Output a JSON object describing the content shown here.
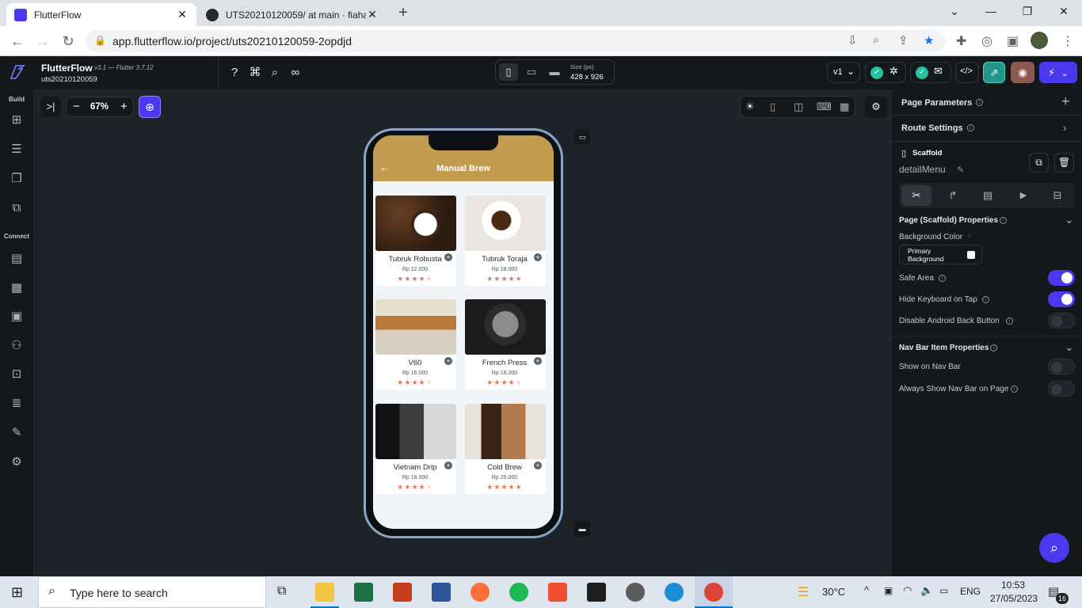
{
  "browser": {
    "tabs": [
      {
        "title": "FlutterFlow",
        "active": true
      },
      {
        "title": "UTS20210120059/ at main · fiaha",
        "active": false
      }
    ],
    "new_tab": "+",
    "window_controls": [
      "⌄",
      "—",
      "❐",
      "✕"
    ],
    "url": "app.flutterflow.io/project/uts20210120059-2opdjd"
  },
  "ff": {
    "brand": "FlutterFlow",
    "version": "v3.1 — Flutter 3.7.12",
    "project": "uts20210120059",
    "device_size_label": "Size (px)",
    "device_size": "428 x 926",
    "version_select": "v1",
    "zoom": "67%",
    "sidebar": {
      "build_label": "Build",
      "connect_label": "Connect"
    }
  },
  "app": {
    "title": "Manual Brew",
    "products": [
      {
        "name": "Tubruk Robusta",
        "price": "Rp 12.000",
        "rating": 4
      },
      {
        "name": "Tubruk Toraja",
        "price": "Rp 18.000",
        "rating": 5
      },
      {
        "name": "V60",
        "price": "Rp 16.000",
        "rating": 4
      },
      {
        "name": "French Press",
        "price": "Rp 16.000",
        "rating": 4
      },
      {
        "name": "Vietnam Drip",
        "price": "Rp 18.000",
        "rating": 4
      },
      {
        "name": "Cold Brew",
        "price": "Rp 25.000",
        "rating": 5
      }
    ]
  },
  "panel": {
    "page_parameters": "Page Parameters",
    "route_settings": "Route Settings",
    "widget_type": "Scaffold",
    "widget_name": "detailMenu",
    "section_page": "Page (Scaffold) Properties",
    "background_color_label": "Background Color",
    "background_color_value": "Primary Background",
    "safe_area": {
      "label": "Safe Area",
      "on": true
    },
    "hide_keyboard": {
      "label": "Hide Keyboard on Tap",
      "on": true
    },
    "disable_back": {
      "label": "Disable Android Back Button",
      "on": false
    },
    "section_nav": "Nav Bar Item Properties",
    "show_nav": {
      "label": "Show on Nav Bar",
      "on": false
    },
    "always_show_nav": {
      "label": "Always Show Nav Bar on Page",
      "on": false
    }
  },
  "taskbar": {
    "search_placeholder": "Type here to search",
    "weather": "30°C",
    "lang": "ENG",
    "time": "10:53",
    "date": "27/05/2023",
    "notif_count": "16"
  },
  "colors": {
    "accent": "#4b39ef",
    "appbar": "#c39b4f",
    "star": "#e4765a"
  }
}
